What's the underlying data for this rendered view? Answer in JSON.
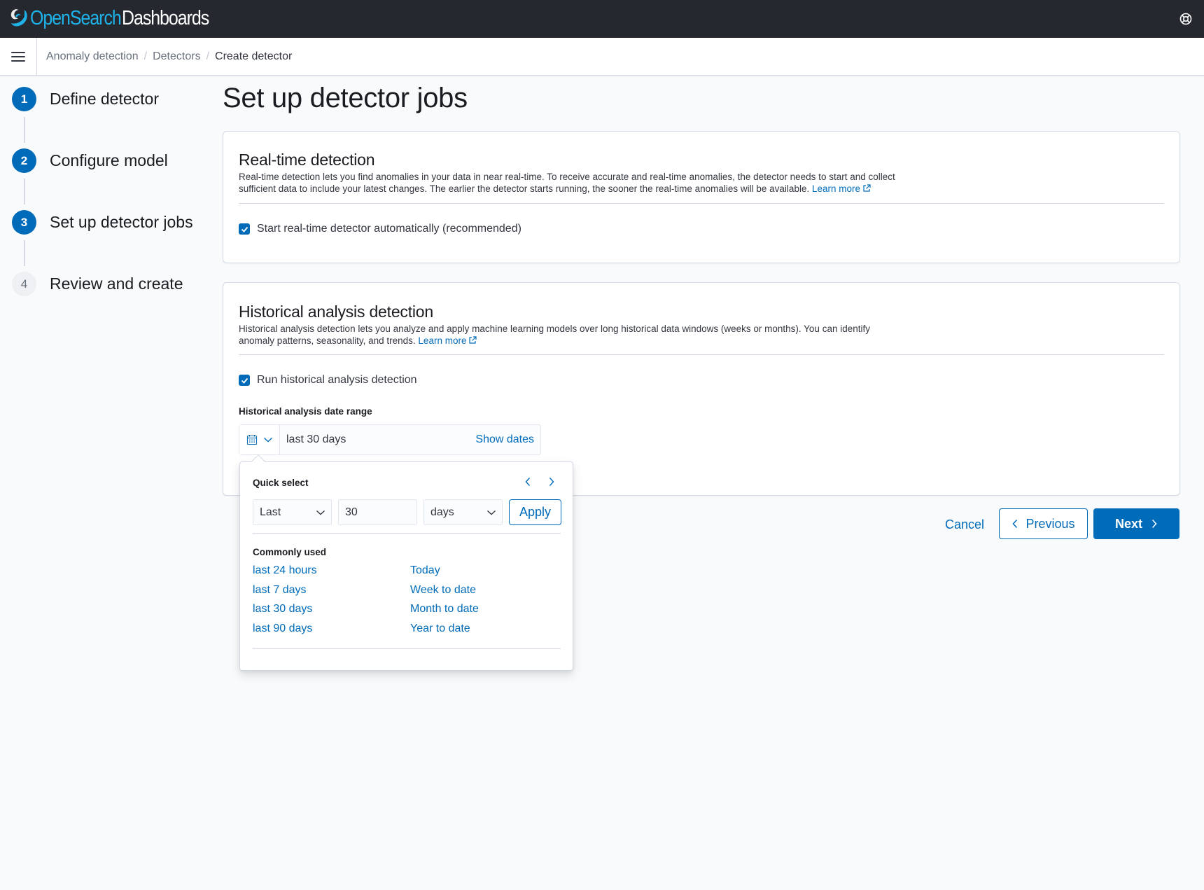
{
  "header": {
    "logo_open": "Open",
    "logo_search": "Search",
    "logo_dashboards": "Dashboards",
    "brand_colors": {
      "open": "#1eb2e8",
      "dashboards": "#ffffff",
      "bar": "#25282f"
    }
  },
  "breadcrumbs": [
    {
      "label": "Anomaly detection"
    },
    {
      "label": "Detectors"
    },
    {
      "label": "Create detector"
    }
  ],
  "steps": [
    {
      "number": "1",
      "label": "Define detector",
      "state": "complete"
    },
    {
      "number": "2",
      "label": "Configure model",
      "state": "complete"
    },
    {
      "number": "3",
      "label": "Set up detector jobs",
      "state": "current"
    },
    {
      "number": "4",
      "label": "Review and create",
      "state": "incomplete"
    }
  ],
  "page": {
    "title": "Set up detector jobs"
  },
  "realtime": {
    "title": "Real-time detection",
    "description_line1": "Real-time detection lets you find anomalies in your data in near real-time. To receive accurate and real-time anomalies, the detector needs to start and collect",
    "description_line2": "sufficient data to include your latest changes. The earlier the detector starts running, the sooner the real-time anomalies will be available.",
    "learn_more": "Learn more",
    "checkbox_label": "Start real-time detector automatically (recommended)",
    "checked": true
  },
  "historical": {
    "title": "Historical analysis detection",
    "description_line1": "Historical analysis detection lets you analyze and apply machine learning models over long historical data windows (weeks or months). You can identify",
    "description_line2": "anomaly patterns, seasonality, and trends.",
    "learn_more": "Learn more",
    "checkbox_label": "Run historical analysis detection",
    "checked": true,
    "date_range_label": "Historical analysis date range",
    "date_range_value": "last 30 days",
    "show_dates": "Show dates"
  },
  "quick_select": {
    "title": "Quick select",
    "direction": "Last",
    "amount": "30",
    "unit": "days",
    "apply": "Apply",
    "commonly_used_title": "Commonly used",
    "commonly_used": [
      "last 24 hours",
      "Today",
      "last 7 days",
      "Week to date",
      "last 30 days",
      "Month to date",
      "last 90 days",
      "Year to date"
    ]
  },
  "footer": {
    "cancel": "Cancel",
    "previous": "Previous",
    "next": "Next"
  },
  "colors": {
    "primary": "#006bb8",
    "text": "#343741",
    "border": "#d3dae6",
    "background": "#f9fafc"
  }
}
